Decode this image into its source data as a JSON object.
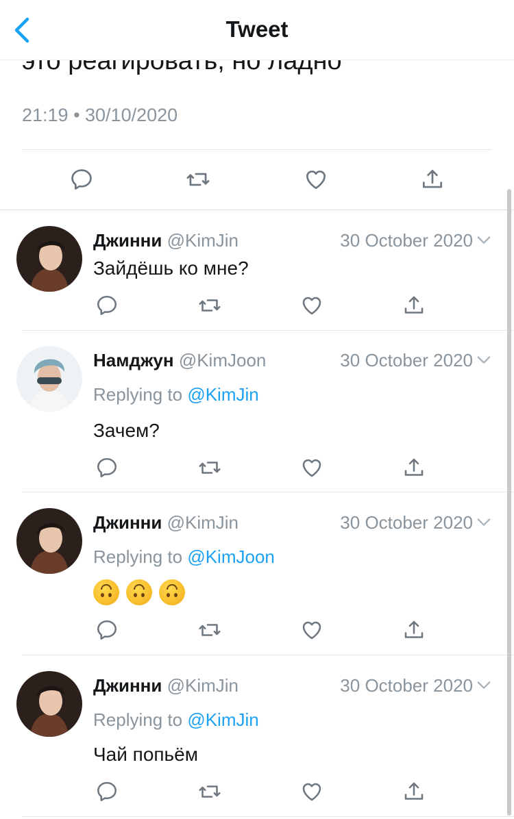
{
  "header": {
    "title": "Tweet",
    "back_icon": "chevron-left-icon"
  },
  "main_tweet": {
    "text": "это реагировать, но ладно",
    "timestamp": "21:19 • 30/10/2020"
  },
  "colors": {
    "accent": "#1da1f2",
    "muted": "#8a949c",
    "text": "#14171a"
  },
  "icons": [
    "reply-icon",
    "retweet-icon",
    "like-icon",
    "share-icon",
    "chevron-down-icon"
  ],
  "replies": [
    {
      "name": "Джинни",
      "handle": "@KimJin",
      "date": "30 October 2020",
      "replying_label": "",
      "replying_to": "",
      "text": "Зайдёшь ко мне?"
    },
    {
      "name": "Намджун",
      "handle": "@KimJoon",
      "date": "30 October 2020",
      "replying_label": "Replying to ",
      "replying_to": "@KimJin",
      "text": "Зачем?"
    },
    {
      "name": "Джинни",
      "handle": "@KimJin",
      "date": "30 October 2020",
      "replying_label": "Replying to ",
      "replying_to": "@KimJoon",
      "emoji": "upside-down-face",
      "emoji_count": 3
    },
    {
      "name": "Джинни",
      "handle": "@KimJin",
      "date": "30 October 2020",
      "replying_label": "Replying to ",
      "replying_to": "@KimJin",
      "text": "Чай попьём"
    }
  ]
}
